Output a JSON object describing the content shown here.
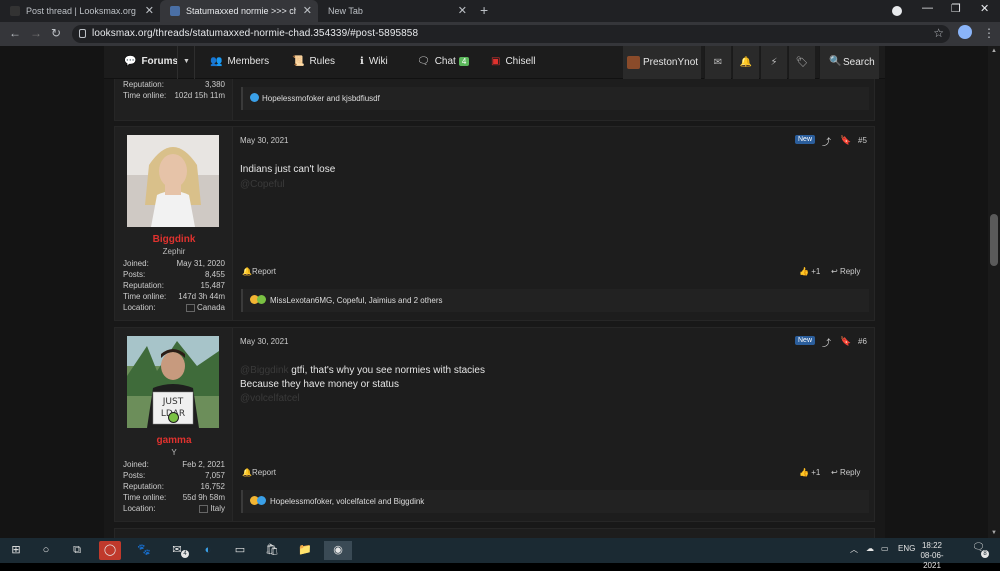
{
  "browser": {
    "tabs": [
      {
        "title": "Post thread | Looksmax.org - Me",
        "active": false
      },
      {
        "title": "Statumaxxed normie >>> chad | ",
        "active": true
      },
      {
        "title": "New Tab",
        "active": false
      }
    ],
    "url": "looksmax.org/threads/statumaxxed-normie-chad.354339/#post-5895858"
  },
  "nav": {
    "forums": "Forums",
    "members": "Members",
    "rules": "Rules",
    "wiki": "Wiki",
    "chat": "Chat",
    "chat_count": "4",
    "chisell": "Chisell",
    "user": "PrestonYnot",
    "search": "Search"
  },
  "prev_post": {
    "reputation_label": "Reputation:",
    "reputation": "3,380",
    "time_label": "Time online:",
    "time": "102d 15h 11m",
    "reactions": "Hopelessmofoker and kjsbdfiusdf"
  },
  "posts": [
    {
      "date": "May 30, 2021",
      "badge": "New",
      "number": "#5",
      "username": "Biggdink",
      "user_title": "Zephir",
      "stats": [
        {
          "label": "Joined:",
          "value": "May 31, 2020"
        },
        {
          "label": "Posts:",
          "value": "8,455"
        },
        {
          "label": "Reputation:",
          "value": "15,487"
        },
        {
          "label": "Time online:",
          "value": "147d 3h 44m"
        },
        {
          "label": "Location:",
          "value": "Canada"
        }
      ],
      "lines": [
        "Indians just can't lose"
      ],
      "mention_after": "@Copeful",
      "report": "Report",
      "like": "+1",
      "reply": "Reply",
      "reactions": "MissLexotan6MG, Copeful, Jaimius and 2 others"
    },
    {
      "date": "May 30, 2021",
      "badge": "New",
      "number": "#6",
      "username": "gamma",
      "user_title": "Y",
      "stats": [
        {
          "label": "Joined:",
          "value": "Feb 2, 2021"
        },
        {
          "label": "Posts:",
          "value": "7,057"
        },
        {
          "label": "Reputation:",
          "value": "16,752"
        },
        {
          "label": "Time online:",
          "value": "55d 9h 58m"
        },
        {
          "label": "Location:",
          "value": "Italy"
        }
      ],
      "mention_before": "@Biggdink",
      "lines": [
        "gtfi, that's why you see normies with stacies",
        "Because they have money or status"
      ],
      "mention_after": "@volcelfatcel",
      "report": "Report",
      "like": "+1",
      "reply": "Reply",
      "reactions": "Hopelessmofoker, volcelfatcel and Biggdink"
    }
  ],
  "taskbar": {
    "lang": "ENG",
    "time": "18:22",
    "date": "08-06-2021",
    "notif_count": "8",
    "mail_count": "4"
  },
  "colors": {
    "username": "#e0322e",
    "new_badge": "#2b5e9c",
    "chat_badge": "#5cb85c"
  }
}
